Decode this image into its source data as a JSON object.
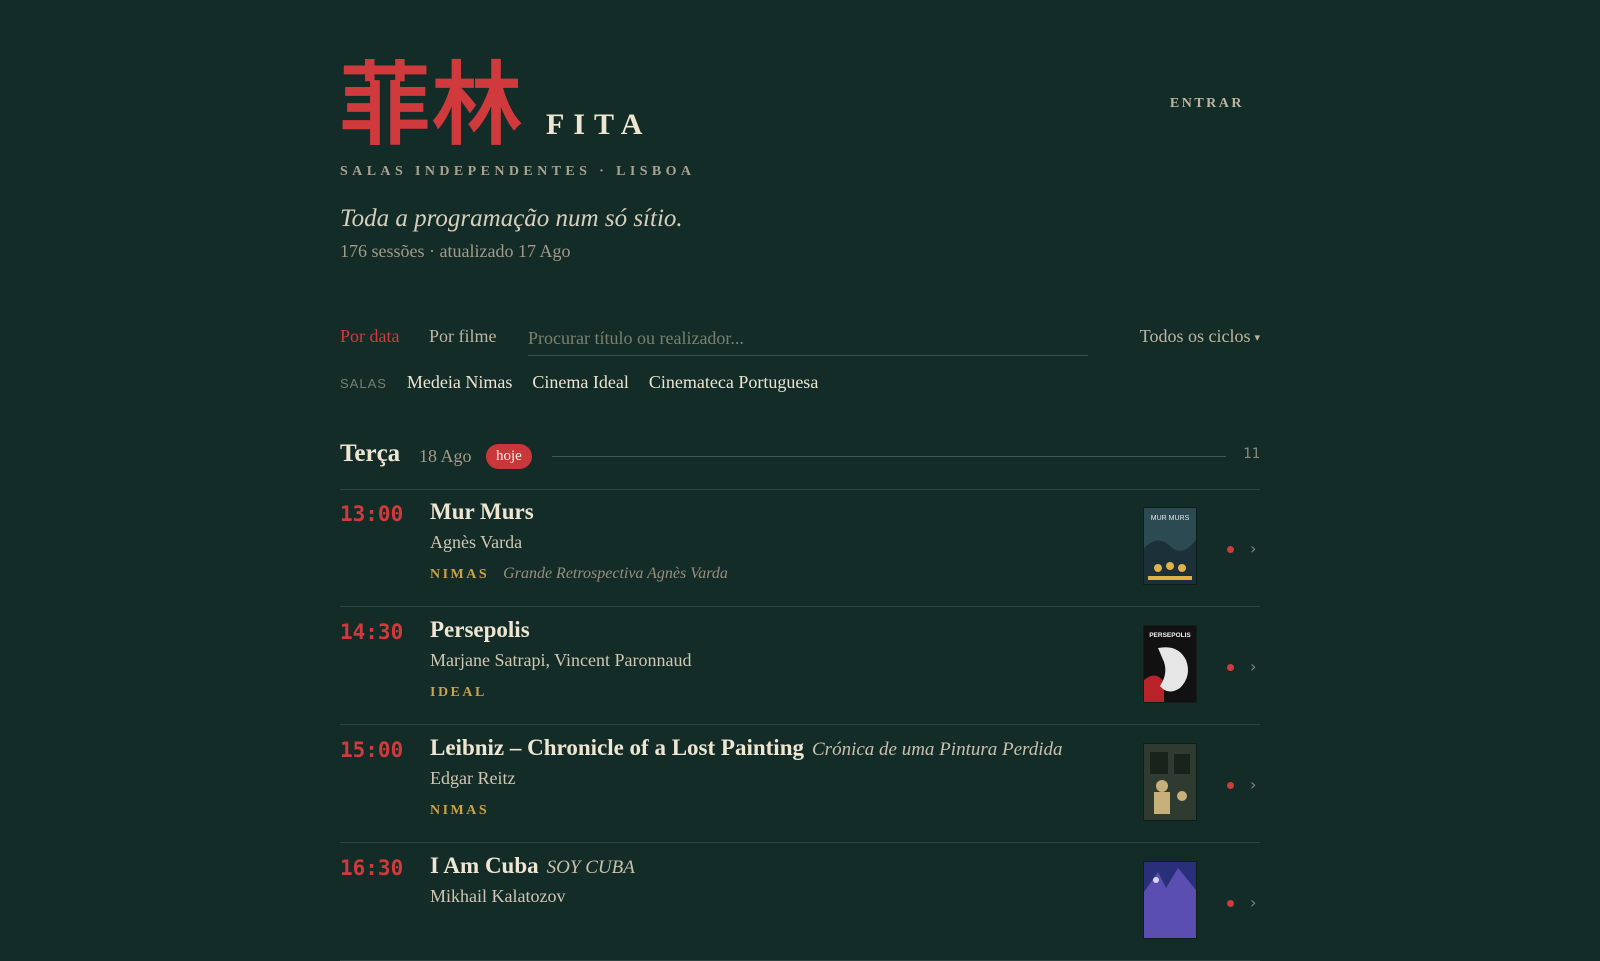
{
  "header": {
    "logo_cjk": "菲林",
    "logo_word": "FITA",
    "subtitle": "SALAS INDEPENDENTES · LISBOA",
    "login_label": "ENTRAR",
    "tagline": "Toda a programação num só sítio.",
    "meta": "176 sessões · atualizado 17 Ago"
  },
  "controls": {
    "tab_by_date": "Por data",
    "tab_by_film": "Por filme",
    "active_tab": "Por data",
    "search_placeholder": "Procurar título ou realizador...",
    "search_value": "",
    "cycles_label": "Todos os ciclos",
    "cycles_caret": "▾"
  },
  "rooms": {
    "label": "SALAS",
    "items": [
      "Medeia Nimas",
      "Cinema Ideal",
      "Cinemateca Portuguesa"
    ]
  },
  "day": {
    "name": "Terça",
    "date": "18 Ago",
    "badge": "hoje",
    "count": "11"
  },
  "sessions": [
    {
      "time": "13:00",
      "title": "Mur Murs",
      "alt_title": "",
      "director": "Agnès Varda",
      "venue": "NIMAS",
      "cycle": "Grande Retrospectiva Agnès Varda",
      "poster_text": "MUR MURS",
      "poster_colors": [
        "#2b4a52",
        "#1b3038",
        "#e0b04a"
      ]
    },
    {
      "time": "14:30",
      "title": "Persepolis",
      "alt_title": "",
      "director": "Marjane Satrapi, Vincent Paronnaud",
      "venue": "IDEAL",
      "cycle": "",
      "poster_text": "PERSEPOLIS",
      "poster_colors": [
        "#111111",
        "#b8232a",
        "#e6e6e6"
      ]
    },
    {
      "time": "15:00",
      "title": "Leibniz – Chronicle of a Lost Painting",
      "alt_title": "Crónica de uma Pintura Perdida",
      "director": "Edgar Reitz",
      "venue": "NIMAS",
      "cycle": "",
      "poster_text": "",
      "poster_colors": [
        "#2f3a30",
        "#1a221c",
        "#c7b07a"
      ]
    },
    {
      "time": "16:30",
      "title": "I Am Cuba",
      "alt_title": "SOY CUBA",
      "director": "Mikhail Kalatozov",
      "venue": "",
      "cycle": "",
      "poster_text": "",
      "poster_colors": [
        "#2a2f7a",
        "#5a4fb0",
        "#d9d6f2"
      ]
    }
  ],
  "colors": {
    "background": "#142c28",
    "accent": "#d03a3d",
    "venue": "#c9a24a"
  },
  "icons": {
    "status": "live-dot-icon",
    "open": "chevron-right-icon",
    "dropdown": "caret-down-icon"
  }
}
